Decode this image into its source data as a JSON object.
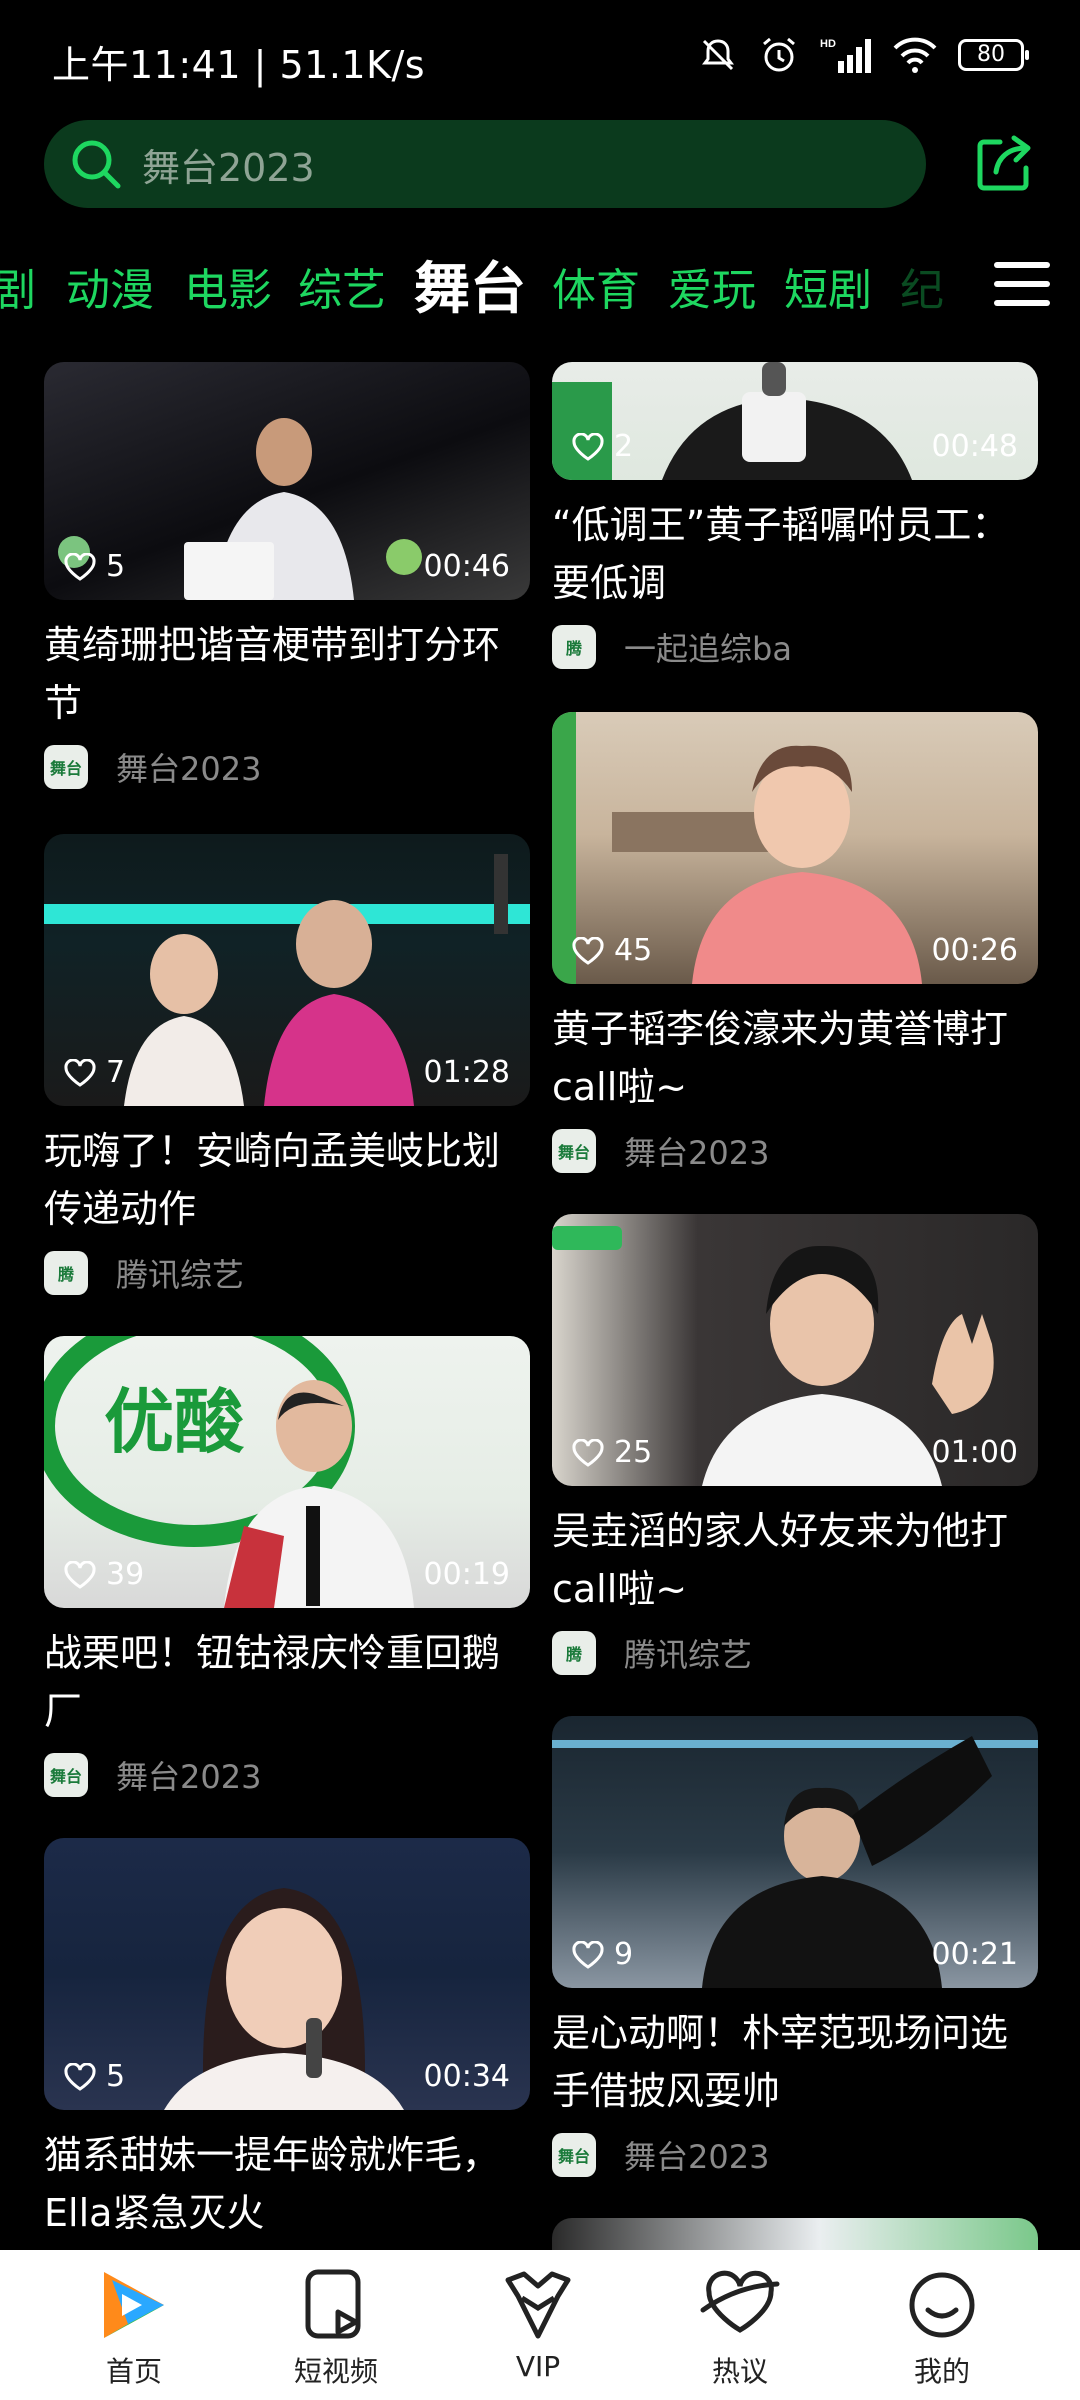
{
  "status_bar": {
    "time_speed": "上午11:41 | 51.1K/s",
    "battery": "80",
    "icons": [
      "mute-icon",
      "alarm-icon",
      "hd-signal-icon",
      "wifi-icon",
      "battery-icon"
    ]
  },
  "search": {
    "placeholder": "舞台2023",
    "icon": "search-icon"
  },
  "share": {
    "icon": "share-icon"
  },
  "tabs": [
    "剧",
    "动漫",
    "电影",
    "综艺",
    "舞台",
    "体育",
    "爱玩",
    "短剧",
    "纪"
  ],
  "active_tab": "舞台",
  "colors": {
    "accent": "#1ed760",
    "search_bg": "#0b3a1d",
    "bg": "#000000"
  },
  "left_column": [
    {
      "likes": "5",
      "duration": "00:46",
      "title": "黄绮珊把谐音梗带到打分环节",
      "author": "舞台2023",
      "avatar_text": "舞台"
    },
    {
      "likes": "7",
      "duration": "01:28",
      "title": "玩嗨了！安崎向孟美岐比划传递动作",
      "author": "腾讯综艺",
      "avatar_text": "腾"
    },
    {
      "likes": "39",
      "duration": "00:19",
      "title": "战栗吧！钮钴禄庆怜重回鹅厂",
      "author": "舞台2023",
      "avatar_text": "舞台"
    },
    {
      "likes": "5",
      "duration": "00:34",
      "title": "猫系甜妹一提年龄就炸毛，Ella紧急灭火",
      "author": "",
      "avatar_text": ""
    }
  ],
  "right_column": [
    {
      "likes": "2",
      "duration": "00:48",
      "title": "“低调王”黄子韬嘱咐员工：要低调",
      "author": "一起追综ba",
      "avatar_text": "腾"
    },
    {
      "likes": "45",
      "duration": "00:26",
      "title": "黄子韬李俊濠来为黄誉博打call啦~",
      "author": "舞台2023",
      "avatar_text": "舞台"
    },
    {
      "likes": "25",
      "duration": "01:00",
      "title": "吴垚滔的家人好友来为他打call啦~",
      "author": "腾讯综艺",
      "avatar_text": "腾"
    },
    {
      "likes": "9",
      "duration": "00:21",
      "title": "是心动啊！朴宰范现场问选手借披风耍帅",
      "author": "舞台2023",
      "avatar_text": "舞台"
    }
  ],
  "bottom_nav": [
    {
      "label": "首页",
      "icon": "home-play-icon"
    },
    {
      "label": "短视频",
      "icon": "short-video-icon"
    },
    {
      "label": "VIP",
      "icon": "vip-crown-icon"
    },
    {
      "label": "热议",
      "icon": "heart-chat-icon"
    },
    {
      "label": "我的",
      "icon": "profile-smile-icon"
    }
  ]
}
